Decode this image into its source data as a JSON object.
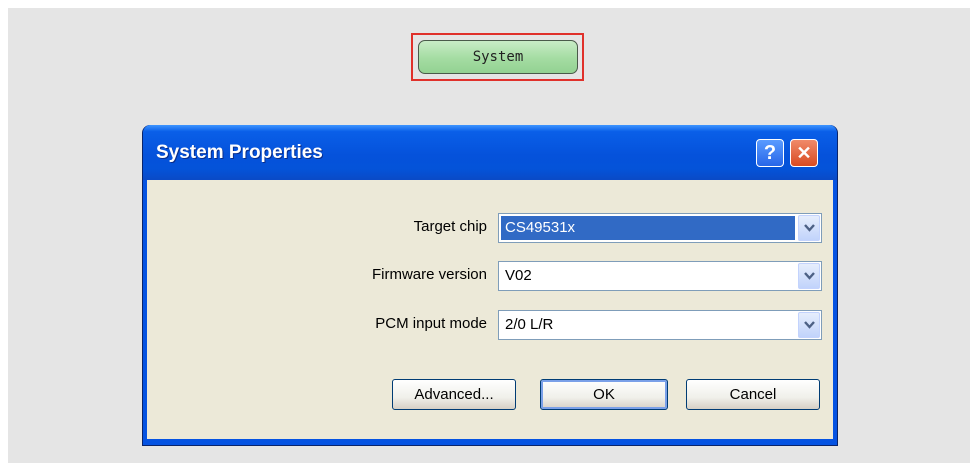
{
  "canvas": {
    "system_node_label": "System"
  },
  "dialog": {
    "title": "System Properties",
    "help_glyph": "?",
    "close_glyph": "✕",
    "fields": [
      {
        "label": "Target chip",
        "value": "CS49531x"
      },
      {
        "label": "Firmware version",
        "value": "V02"
      },
      {
        "label": "PCM input mode",
        "value": "2/0 L/R"
      }
    ],
    "buttons": {
      "advanced": "Advanced...",
      "ok": "OK",
      "cancel": "Cancel"
    }
  },
  "icons": {
    "help": "help-icon",
    "close": "close-icon",
    "dropdown": "chevron-down-icon"
  },
  "colors": {
    "title_bar": "#0553e2",
    "node_fill": "#a4dca2",
    "selection_border": "#e0312b",
    "selection_highlight": "#316ac5"
  }
}
